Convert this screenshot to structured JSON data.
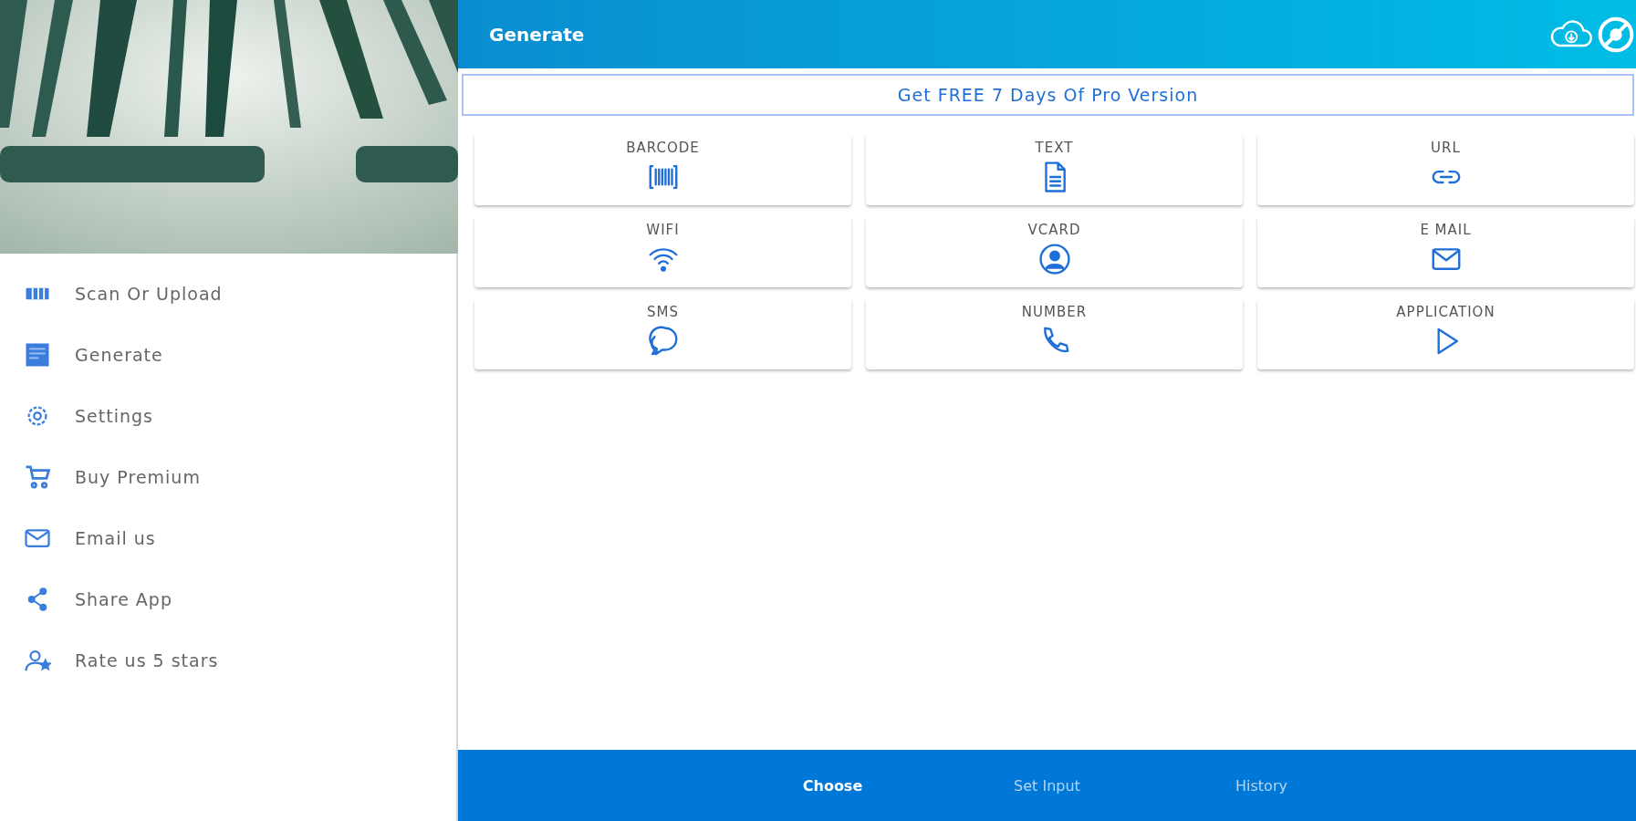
{
  "header": {
    "title": "Generate"
  },
  "sidebar": {
    "items": [
      {
        "label": "Scan Or Upload"
      },
      {
        "label": "Generate"
      },
      {
        "label": "Settings"
      },
      {
        "label": "Buy Premium"
      },
      {
        "label": "Email us"
      },
      {
        "label": "Share App"
      },
      {
        "label": "Rate us 5 stars"
      }
    ]
  },
  "promo": {
    "label": "Get FREE 7 Days Of Pro Version"
  },
  "types": [
    {
      "label": "BARCODE"
    },
    {
      "label": "TEXT"
    },
    {
      "label": "URL"
    },
    {
      "label": "WIFI"
    },
    {
      "label": "VCARD"
    },
    {
      "label": "E MAIL"
    },
    {
      "label": "SMS"
    },
    {
      "label": "NUMBER"
    },
    {
      "label": "APPLICATION"
    }
  ],
  "bottom_tabs": [
    {
      "label": "Choose",
      "selected": true
    },
    {
      "label": "Set Input",
      "selected": false
    },
    {
      "label": "History",
      "selected": false
    }
  ]
}
